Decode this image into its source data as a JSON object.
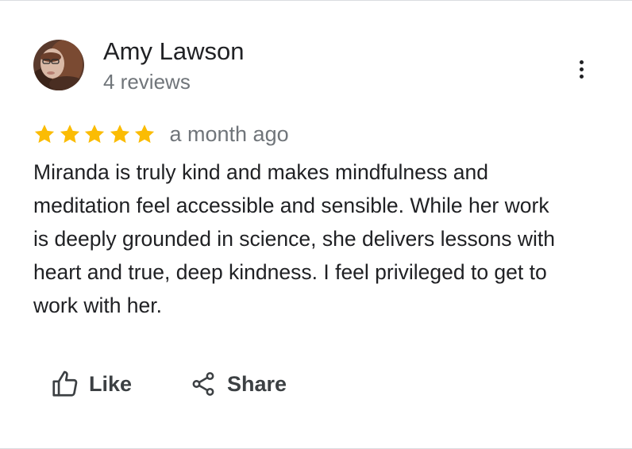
{
  "review": {
    "author": {
      "name": "Amy Lawson",
      "meta": "4 reviews",
      "avatar_icon": "profile-photo"
    },
    "rating": {
      "stars": 5,
      "max_stars": 5,
      "star_color": "#fbbc04"
    },
    "time_ago": "a month ago",
    "text": "Miranda is truly kind and makes mindfulness and meditation feel accessible and sensible. While her work is deeply grounded in science, she delivers lessons with heart and true, deep kindness. I feel privileged to get to work with her.",
    "more_icon": "more-vert-icon"
  },
  "actions": {
    "like_label": "Like",
    "like_icon": "thumb-up-icon",
    "share_label": "Share",
    "share_icon": "share-icon"
  }
}
